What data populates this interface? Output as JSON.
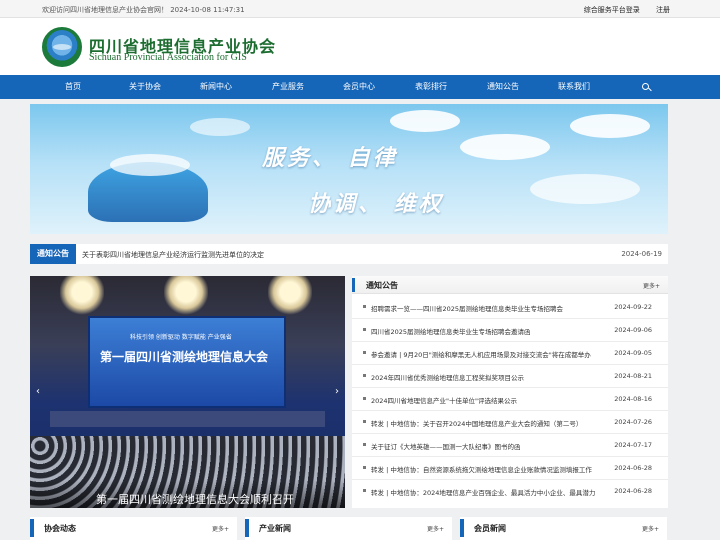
{
  "topbar": {
    "welcome": "欢迎访问四川省地理信息产业协会官网！ 2024-10-08 11:47:31",
    "service_login": "综合服务平台登录",
    "register": "注册"
  },
  "logo": {
    "name_cn": "四川省地理信息产业协会",
    "name_en": "Sichuan Provincial Association for GIS"
  },
  "nav": {
    "items": [
      "首页",
      "关于协会",
      "新闻中心",
      "产业服务",
      "会员中心",
      "表彰排行",
      "通知公告",
      "联系我们"
    ],
    "search_icon": "search-icon"
  },
  "banner": {
    "line1": "服务、 自律",
    "line2": "协调、 维权"
  },
  "notice_bar": {
    "tag": "通知公告",
    "text": "关于表彰四川省地理信息产业经济运行监测先进单位的决定",
    "date": "2024-06-19"
  },
  "photo": {
    "screen_sub": "科技引领 创新驱动 数字赋能 产业强省",
    "screen_title": "第一届四川省测绘地理信息大会",
    "caption": "第一届四川省测绘地理信息大会顺利召开",
    "prev": "‹",
    "next": "›"
  },
  "notice_panel": {
    "title": "通知公告",
    "more": "更多+",
    "items": [
      {
        "text": "招聘需求一览——四川省2025届测绘地理信息类毕业生专场招聘会",
        "date": "2024-09-22"
      },
      {
        "text": "四川省2025届测绘地理信息类毕业生专场招聘会邀请函",
        "date": "2024-09-06"
      },
      {
        "text": "参会邀请 | 9月20日\"测绘和摩黑无人机应用场景及对接交流会\"将在成都举办",
        "date": "2024-09-05"
      },
      {
        "text": "2024年四川省优秀测绘地理信息工程奖拟奖项目公示",
        "date": "2024-08-21"
      },
      {
        "text": "2024四川省地理信息产业\"十佳单位\"评选结果公示",
        "date": "2024-08-16"
      },
      {
        "text": "转发 | 中地信协：关于召开2024中国地理信息产业大会的通知（第二号）",
        "date": "2024-07-26"
      },
      {
        "text": "关于征订《大地英雄——国测一大队纪事》图书的函",
        "date": "2024-07-17"
      },
      {
        "text": "转发 | 中地信协：自然资源系统拖欠测绘地理信息企业账款情况监测填报工作",
        "date": "2024-06-28"
      },
      {
        "text": "转发 | 中地信协：2024地理信息产业百强企业、最具活力中小企业、最具潜力",
        "date": "2024-06-28"
      }
    ]
  },
  "bottom_sections": [
    {
      "title": "协会动态",
      "more": "更多+"
    },
    {
      "title": "产业新闻",
      "more": "更多+"
    },
    {
      "title": "会员新闻",
      "more": "更多+"
    }
  ]
}
